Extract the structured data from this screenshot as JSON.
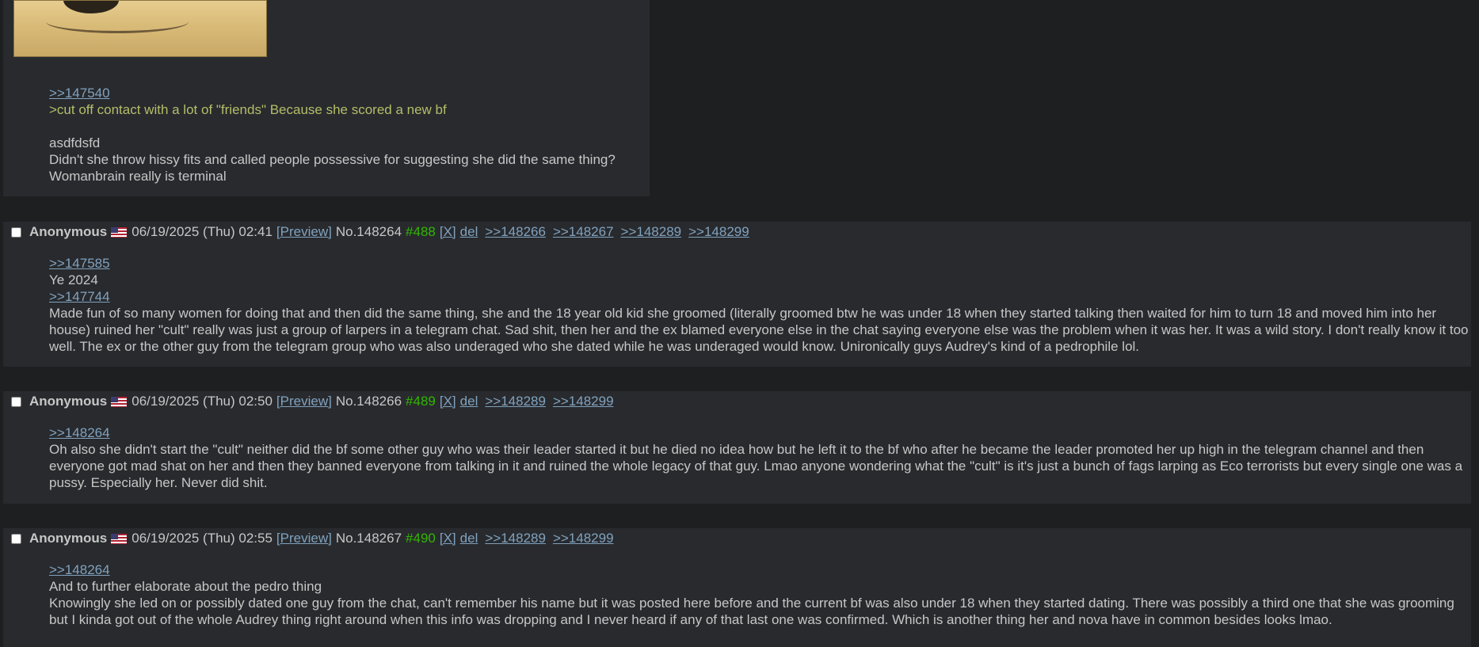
{
  "posts": [
    {
      "lines": [
        {
          "type": "quote",
          "text": ">>147540"
        },
        {
          "type": "green",
          "text": ">cut off contact with a lot of \"friends\" Because she scored a new bf"
        },
        {
          "type": "blank",
          "text": ""
        },
        {
          "type": "text",
          "text": "asdfdsfd"
        },
        {
          "type": "text",
          "text": "Didn't she throw hissy fits and called people possessive for suggesting she did the same thing?"
        },
        {
          "type": "text",
          "text": "Womanbrain really is terminal"
        }
      ]
    },
    {
      "name": "Anonymous",
      "date": "06/19/2025 (Thu) 02:41",
      "preview": "[Preview]",
      "no": "No.148264",
      "count": "#488",
      "x": "[X]",
      "del": "del",
      "backlinks": [
        ">>148266",
        ">>148267",
        ">>148289",
        ">>148299"
      ],
      "lines": [
        {
          "type": "quote",
          "text": ">>147585"
        },
        {
          "type": "text",
          "text": "Ye 2024"
        },
        {
          "type": "quote",
          "text": ">>147744"
        },
        {
          "type": "para",
          "text": "Made fun of so many women for doing that and then did the same thing, she and the 18 year old kid she groomed (literally groomed btw he was under 18 when they started talking then waited for him to turn 18 and moved him into her house) ruined her \"cult\" really was just a group of larpers in a telegram chat. Sad shit, then her and the ex blamed everyone else in the chat saying everyone else was the problem when it was her. It was a wild story. I don't really know it too well. The ex or the other guy from the telegram group who was also underaged who she dated while he was underaged would know. Unironically guys Audrey's kind of a pedrophile lol."
        }
      ]
    },
    {
      "name": "Anonymous",
      "date": "06/19/2025 (Thu) 02:50",
      "preview": "[Preview]",
      "no": "No.148266",
      "count": "#489",
      "x": "[X]",
      "del": "del",
      "backlinks": [
        ">>148289",
        ">>148299"
      ],
      "lines": [
        {
          "type": "quote",
          "text": ">>148264"
        },
        {
          "type": "para",
          "text": "Oh also she didn't start the \"cult\" neither did the bf some other guy who was their leader started it but he died no idea how but he left it to the bf who after he became the leader promoted her up high in the telegram channel and then everyone got mad shat on her and then they banned everyone from talking in it and ruined the whole legacy of that guy. Lmao anyone wondering what the \"cult\" is it's just a bunch of fags larping as Eco terrorists but every single one was a pussy. Especially her. Never did shit."
        }
      ]
    },
    {
      "name": "Anonymous",
      "date": "06/19/2025 (Thu) 02:55",
      "preview": "[Preview]",
      "no": "No.148267",
      "count": "#490",
      "x": "[X]",
      "del": "del",
      "backlinks": [
        ">>148289",
        ">>148299"
      ],
      "lines": [
        {
          "type": "quote",
          "text": ">>148264"
        },
        {
          "type": "text",
          "text": "And to further elaborate about the pedro thing"
        },
        {
          "type": "para",
          "text": "Knowingly she led on or possibly dated one guy from the chat, can't remember his name but it was posted here before and the current bf was also under 18 when they started dating. There was possibly a third one that she was grooming but I kinda got out of the whole Audrey thing right around when this info was dropping and I never heard if any of that last one was confirmed. Which is another thing her and nova have in common besides looks lmao."
        }
      ]
    }
  ]
}
